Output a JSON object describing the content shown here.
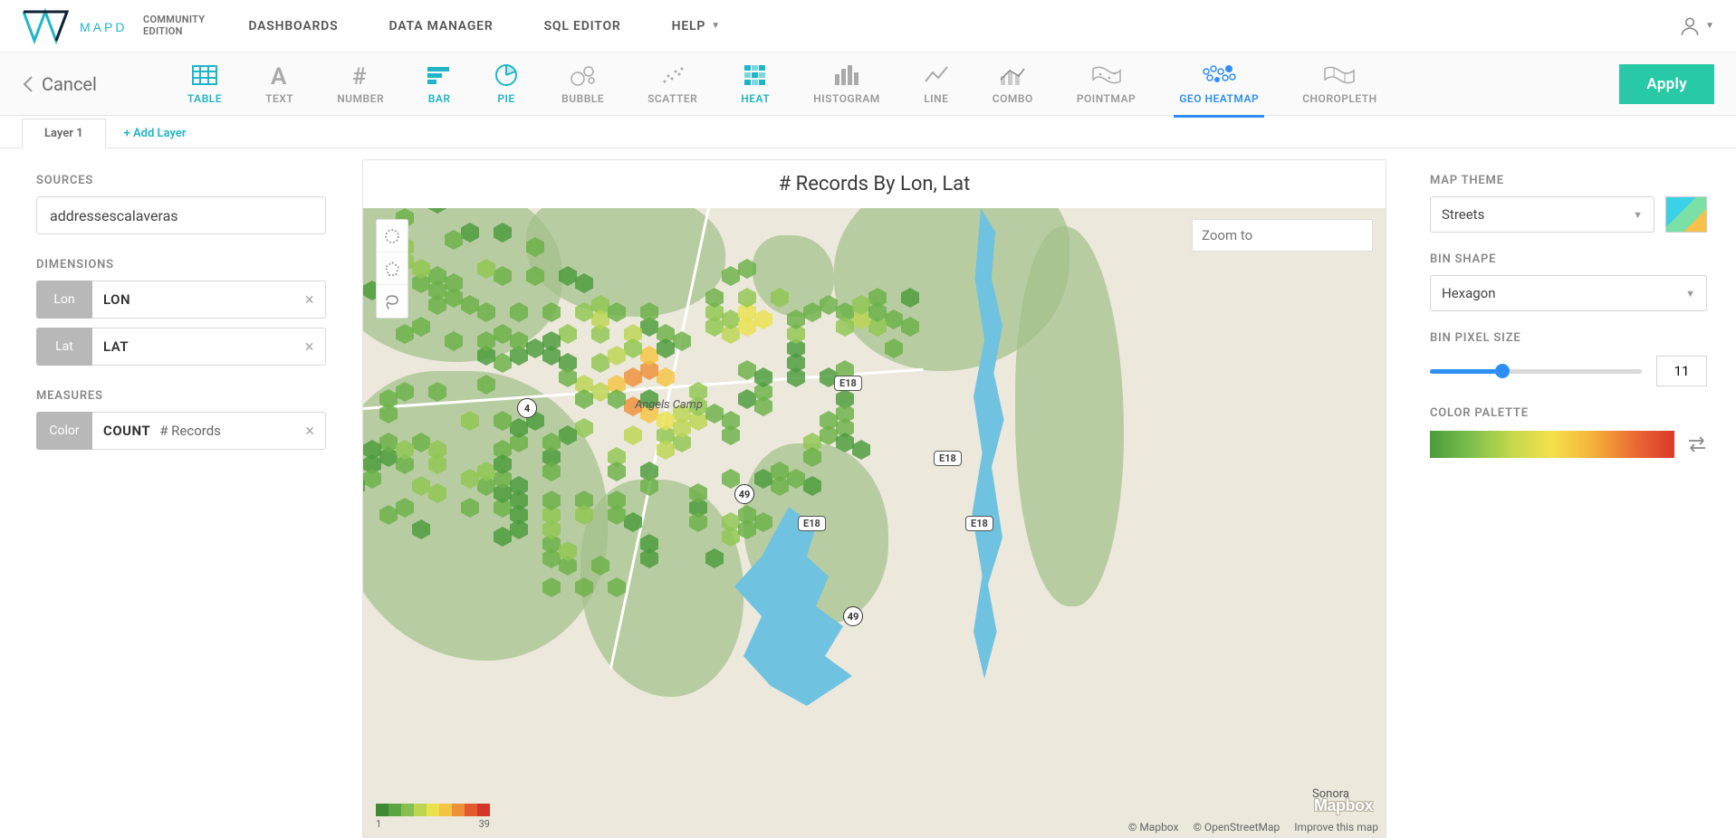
{
  "brand": {
    "name": "MAPD",
    "line1": "COMMUNITY",
    "line2": "EDITION"
  },
  "topnav": {
    "items": [
      "DASHBOARDS",
      "DATA MANAGER",
      "SQL EDITOR",
      "HELP"
    ],
    "help_has_caret": true
  },
  "typebar": {
    "cancel": "Cancel",
    "apply": "Apply",
    "types": [
      {
        "id": "table",
        "label": "TABLE",
        "active": true
      },
      {
        "id": "text",
        "label": "TEXT"
      },
      {
        "id": "number",
        "label": "NUMBER"
      },
      {
        "id": "bar",
        "label": "BAR",
        "active": true
      },
      {
        "id": "pie",
        "label": "PIE",
        "active": true
      },
      {
        "id": "bubble",
        "label": "BUBBLE"
      },
      {
        "id": "scatter",
        "label": "SCATTER"
      },
      {
        "id": "heat",
        "label": "HEAT",
        "active": true
      },
      {
        "id": "histogram",
        "label": "HISTOGRAM"
      },
      {
        "id": "line",
        "label": "LINE"
      },
      {
        "id": "combo",
        "label": "COMBO"
      },
      {
        "id": "pointmap",
        "label": "POINTMAP"
      },
      {
        "id": "geoheatmap",
        "label": "GEO HEATMAP",
        "selected": true
      },
      {
        "id": "choropleth",
        "label": "CHOROPLETH"
      }
    ]
  },
  "layers": {
    "tab": "Layer 1",
    "add": "+ Add Layer"
  },
  "left": {
    "sources_label": "SOURCES",
    "source": "addressescalaveras",
    "dimensions_label": "DIMENSIONS",
    "dims": [
      {
        "tag": "Lon",
        "value": "LON"
      },
      {
        "tag": "Lat",
        "value": "LAT"
      }
    ],
    "measures_label": "MEASURES",
    "measure": {
      "tag": "Color",
      "agg": "COUNT",
      "field": "# Records"
    }
  },
  "map": {
    "title": "# Records By Lon, Lat",
    "zoom_placeholder": "Zoom to",
    "place_angels": "Angels Camp",
    "place_sonora": "Sonora",
    "routes": {
      "r4": "4",
      "r49a": "49",
      "r49b": "49",
      "e18": "E18"
    },
    "legend_min": "1",
    "legend_max": "39",
    "mapbox_word": "Mapbox",
    "attr_mapbox": "© Mapbox",
    "attr_osm": "© OpenStreetMap",
    "attr_improve": "Improve this map"
  },
  "right": {
    "theme_label": "MAP THEME",
    "theme_value": "Streets",
    "bin_shape_label": "BIN SHAPE",
    "bin_shape_value": "Hexagon",
    "bin_size_label": "BIN PIXEL SIZE",
    "bin_size_value": "11",
    "palette_label": "COLOR PALETTE"
  }
}
